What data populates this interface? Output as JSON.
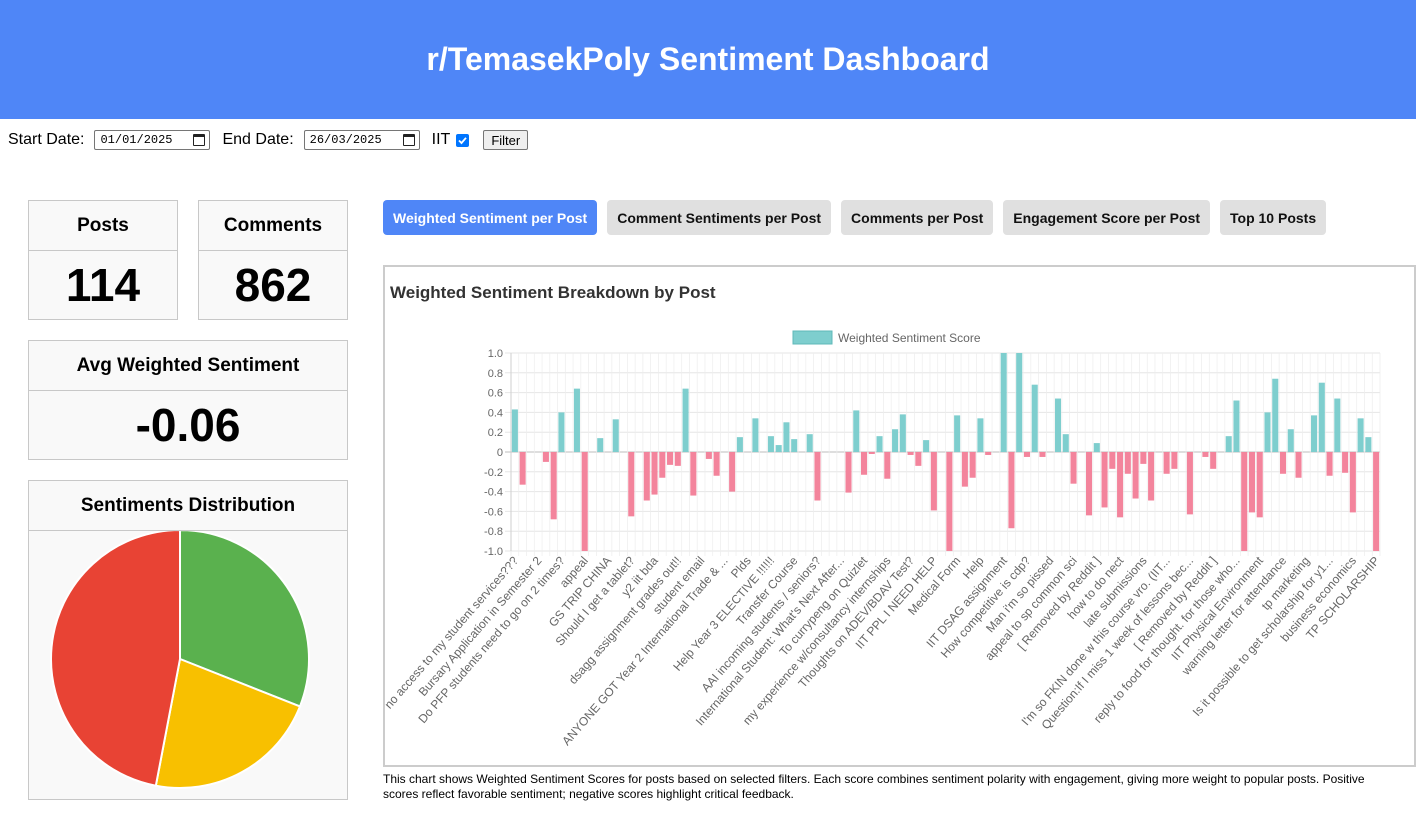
{
  "header": {
    "title": "r/TemasekPoly Sentiment Dashboard"
  },
  "filters": {
    "start_label": "Start Date:",
    "start_value": "01/01/2025",
    "end_label": "End Date:",
    "end_value": "26/03/2025",
    "iit_label": "IIT",
    "iit_checked": true,
    "filter_button": "Filter"
  },
  "stats": {
    "posts_label": "Posts",
    "posts_value": "114",
    "comments_label": "Comments",
    "comments_value": "862",
    "avg_label": "Avg Weighted Sentiment",
    "avg_value": "-0.06"
  },
  "distribution": {
    "title": "Sentiments Distribution",
    "slices": [
      {
        "label": "Positive",
        "fraction": 0.31,
        "color": "#5ab14e"
      },
      {
        "label": "Neutral",
        "fraction": 0.22,
        "color": "#f8c000"
      },
      {
        "label": "Negative",
        "fraction": 0.47,
        "color": "#e84334"
      }
    ]
  },
  "tabs": [
    {
      "label": "Weighted Sentiment per Post",
      "active": true
    },
    {
      "label": "Comment Sentiments per Post",
      "active": false
    },
    {
      "label": "Comments per Post",
      "active": false
    },
    {
      "label": "Engagement Score per Post",
      "active": false
    },
    {
      "label": "Top 10 Posts",
      "active": false
    }
  ],
  "chart_data": {
    "type": "bar",
    "title": "Weighted Sentiment Breakdown by Post",
    "legend": "Weighted Sentiment Score",
    "legend_position": "top",
    "grid": true,
    "ylim": [
      -1.0,
      1.0
    ],
    "yticks": [
      "1.0",
      "0.8",
      "0.6",
      "0.4",
      "0.2",
      "0",
      "-0.2",
      "-0.4",
      "-0.6",
      "-0.8",
      "-1.0"
    ],
    "positive_color": "#7ecece",
    "negative_color": "#f3849c",
    "values": [
      0.43,
      -0.33,
      0,
      0,
      -0.1,
      -0.68,
      0.4,
      0,
      0.64,
      -1.0,
      0,
      0.14,
      0,
      0.33,
      0,
      -0.65,
      0,
      -0.49,
      -0.43,
      -0.26,
      -0.13,
      -0.14,
      0.64,
      -0.44,
      0,
      -0.07,
      -0.24,
      0,
      -0.4,
      0.15,
      0,
      0.34,
      0,
      0.16,
      0.07,
      0.3,
      0.13,
      0,
      0.18,
      -0.49,
      0,
      0,
      0,
      -0.41,
      0.42,
      -0.23,
      -0.02,
      0.16,
      -0.27,
      0.23,
      0.38,
      -0.03,
      -0.14,
      0.12,
      -0.59,
      0,
      -1.0,
      0.37,
      -0.35,
      -0.26,
      0.34,
      -0.03,
      0,
      1.0,
      -0.77,
      1.0,
      -0.05,
      0.68,
      -0.05,
      0,
      0.54,
      0.18,
      -0.32,
      0,
      -0.64,
      0.09,
      -0.56,
      -0.17,
      -0.66,
      -0.22,
      -0.47,
      -0.12,
      -0.49,
      0,
      -0.22,
      -0.17,
      0,
      -0.63,
      0,
      -0.05,
      -0.17,
      0,
      0.16,
      0.52,
      -1.0,
      -0.61,
      -0.66,
      0.4,
      0.74,
      -0.22,
      0.23,
      -0.26,
      0,
      0.37,
      0.7,
      -0.24,
      0.54,
      -0.21,
      -0.61,
      0.34,
      0.15,
      -1.0
    ],
    "categories": [
      "no access to my student services???",
      "Bursary Application in Semester 2",
      "Do PFP students need to go on 2 times?",
      "appeal",
      "GS TRIP CHINA",
      "Should I get a tablet?",
      "y2 iit bda",
      "dsagg assignment grades out!!",
      "student email",
      "ANYONE GOT Year 2 International Trade & ...",
      "Plds",
      "Help Year 3 ELECTIVE !!!!!!",
      "Transfer Course",
      "AAI incoming students / seniors?",
      "International Student: What's Next After...",
      "To currypeng on Quizlet",
      "my experience w/consultancy internships",
      "Thoughts on ADEV/BDAV Test?",
      "IIT PPL I NEED HELP",
      "Medical Form",
      "Help",
      "IIT DSAG assignment",
      "How competitive is cdp?",
      "Man i'm so pissed",
      "appeal to sp common sci",
      "[ Removed by Reddit ]",
      "how to do nect",
      "late submissions",
      "I'm so FKIN done w this course vro. (IIT...",
      "Question:If I miss 1 week of lessons bec...",
      "[ Removed by Reddit ]",
      "reply to food for thought. for those who...",
      "IIT Physical Environment",
      "warning letter for attendance",
      "tp marketing",
      "Is it possible to get scholarship for y1...",
      "business economics",
      "TP SCHOLARSHIP"
    ]
  },
  "description": "This chart shows Weighted Sentiment Scores for posts based on selected filters. Each score combines sentiment polarity with engagement, giving more weight to popular posts. Positive scores reflect favorable sentiment; negative scores highlight critical feedback."
}
